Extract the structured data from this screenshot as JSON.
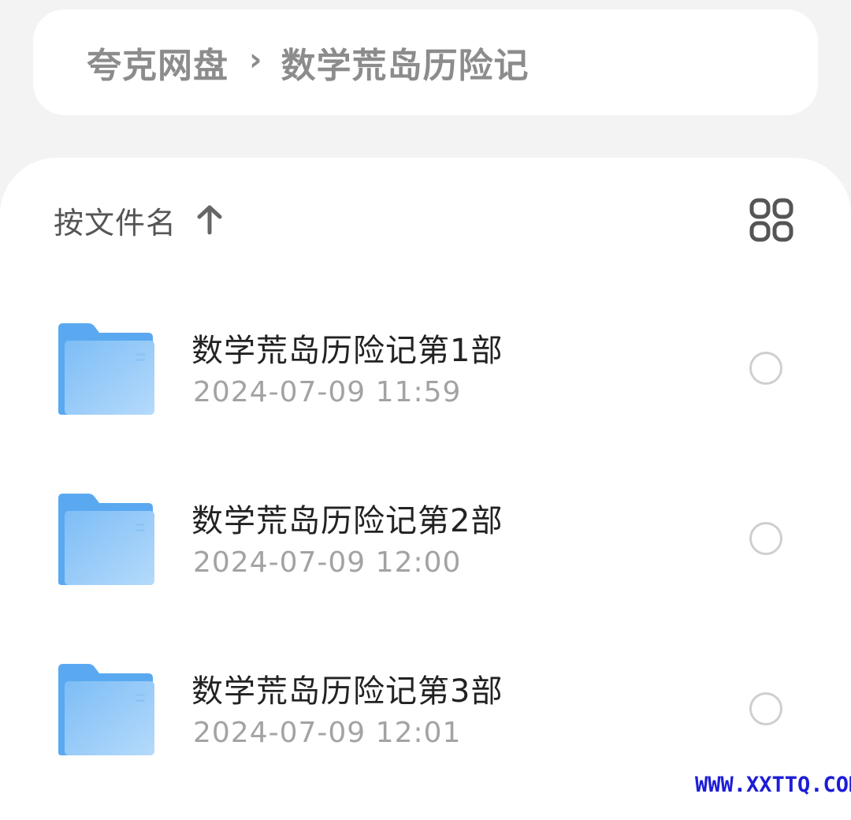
{
  "breadcrumb": {
    "root": "夸克网盘",
    "separator": "›",
    "current": "数学荒岛历险记"
  },
  "toolbar": {
    "sort_label": "按文件名",
    "sort_icon": "arrow-up-icon",
    "view_icon": "grid-view-icon"
  },
  "files": [
    {
      "name": "数学荒岛历险记第1部",
      "date": "2024-07-09 11:59",
      "icon": "folder-icon"
    },
    {
      "name": "数学荒岛历险记第2部",
      "date": "2024-07-09 12:00",
      "icon": "folder-icon"
    },
    {
      "name": "数学荒岛历险记第3部",
      "date": "2024-07-09 12:01",
      "icon": "folder-icon"
    }
  ],
  "watermark": "WWW.XXTTQ.COM",
  "colors": {
    "page_background": "#f3f3f3",
    "card_background": "#ffffff",
    "folder_blue": "#6fb3f5",
    "muted_text": "#8c8c8c"
  }
}
